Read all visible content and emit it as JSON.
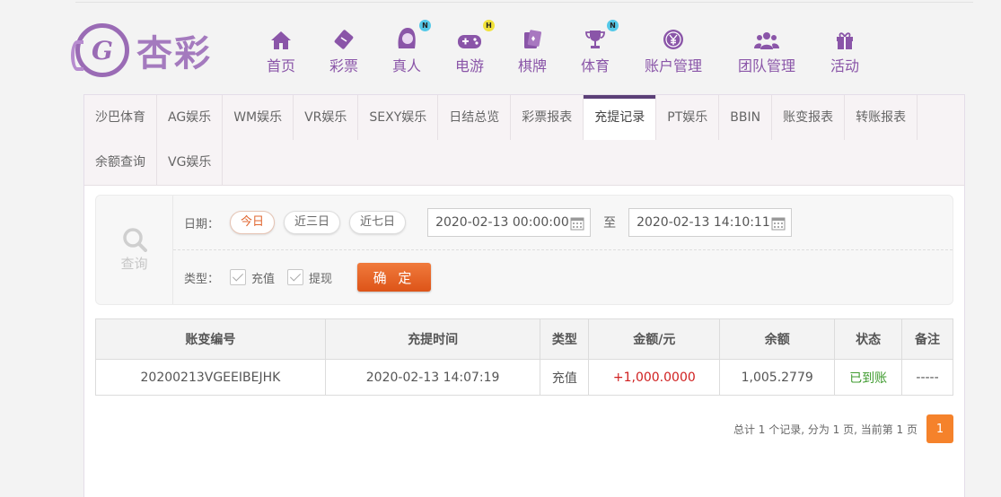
{
  "brand": {
    "logo_text": "杏彩",
    "logo_mark": "G"
  },
  "nav": [
    {
      "label": "首页",
      "icon": "home-icon",
      "badge": ""
    },
    {
      "label": "彩票",
      "icon": "lottery-ticket-icon",
      "badge": ""
    },
    {
      "label": "真人",
      "icon": "live-dealer-icon",
      "badge": "N"
    },
    {
      "label": "电游",
      "icon": "gamepad-icon",
      "badge": "H"
    },
    {
      "label": "棋牌",
      "icon": "cards-icon",
      "badge": ""
    },
    {
      "label": "体育",
      "icon": "trophy-icon",
      "badge": "N"
    },
    {
      "label": "账户管理",
      "icon": "yen-coin-icon",
      "badge": ""
    },
    {
      "label": "团队管理",
      "icon": "team-icon",
      "badge": ""
    },
    {
      "label": "活动",
      "icon": "gift-icon",
      "badge": ""
    }
  ],
  "tabs": [
    "沙巴体育",
    "AG娱乐",
    "WM娱乐",
    "VR娱乐",
    "SEXY娱乐",
    "日结总览",
    "彩票报表",
    "充提记录",
    "PT娱乐",
    "BBIN",
    "账变报表",
    "转账报表",
    "余额查询",
    "VG娱乐"
  ],
  "active_tab": "充提记录",
  "search": {
    "side_label": "查询",
    "date_label": "日期：",
    "ranges": [
      "今日",
      "近三日",
      "近七日"
    ],
    "active_range": "今日",
    "start_date": "2020-02-13 00:00:00",
    "to_label": "至",
    "end_date": "2020-02-13 14:10:11",
    "type_label": "类型：",
    "types": [
      "充值",
      "提现"
    ],
    "confirm_label": "确 定"
  },
  "table": {
    "headers": [
      "账变编号",
      "充提时间",
      "类型",
      "金额/元",
      "余额",
      "状态",
      "备注"
    ],
    "rows": [
      [
        "20200213VGEEIBEJHK",
        "2020-02-13 14:07:19",
        "充值",
        "+1,000.0000",
        "1,005.2779",
        "已到账",
        "-----"
      ]
    ]
  },
  "pager": {
    "summary": "总计 1 个记录, 分为 1 页, 当前第 1 页",
    "current": "1"
  },
  "colors": {
    "brand_purple": "#8a55a8",
    "active_tab_bar": "#5b3f77",
    "accent_orange": "#e0662f",
    "amount_red": "#d02020",
    "status_green": "#3f9b2f"
  }
}
